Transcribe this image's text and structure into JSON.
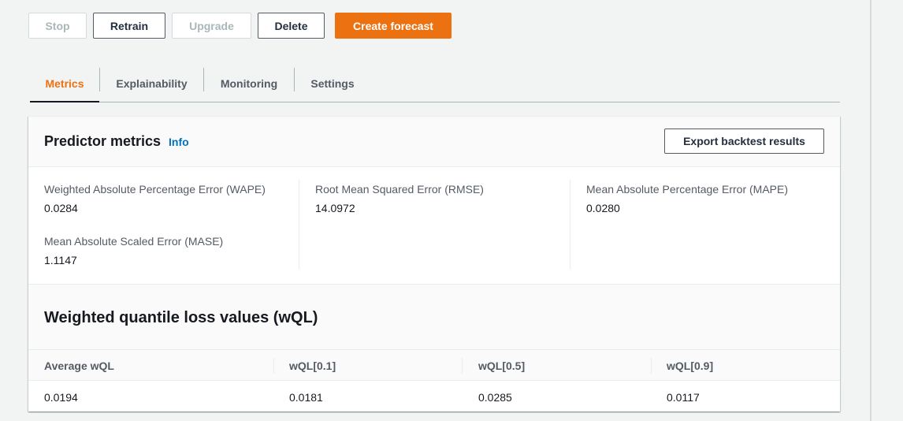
{
  "toolbar": {
    "stop_label": "Stop",
    "retrain_label": "Retrain",
    "upgrade_label": "Upgrade",
    "delete_label": "Delete",
    "create_forecast_label": "Create forecast"
  },
  "tabs": [
    {
      "label": "Metrics",
      "active": true
    },
    {
      "label": "Explainability",
      "active": false
    },
    {
      "label": "Monitoring",
      "active": false
    },
    {
      "label": "Settings",
      "active": false
    }
  ],
  "predictor_metrics": {
    "title": "Predictor metrics",
    "info_label": "Info",
    "export_label": "Export backtest results",
    "metrics": [
      {
        "label": "Weighted Absolute Percentage Error (WAPE)",
        "value": "0.0284"
      },
      {
        "label": "Mean Absolute Scaled Error (MASE)",
        "value": "1.1147"
      },
      {
        "label": "Root Mean Squared Error (RMSE)",
        "value": "14.0972"
      },
      {
        "label": "Mean Absolute Percentage Error (MAPE)",
        "value": "0.0280"
      }
    ]
  },
  "wql": {
    "title": "Weighted quantile loss values (wQL)",
    "headers": [
      "Average wQL",
      "wQL[0.1]",
      "wQL[0.5]",
      "wQL[0.9]"
    ],
    "values": [
      "0.0194",
      "0.0181",
      "0.0285",
      "0.0117"
    ]
  },
  "colors": {
    "accent": "#ec7211",
    "link": "#0073bb",
    "background": "#f2f3f3"
  }
}
